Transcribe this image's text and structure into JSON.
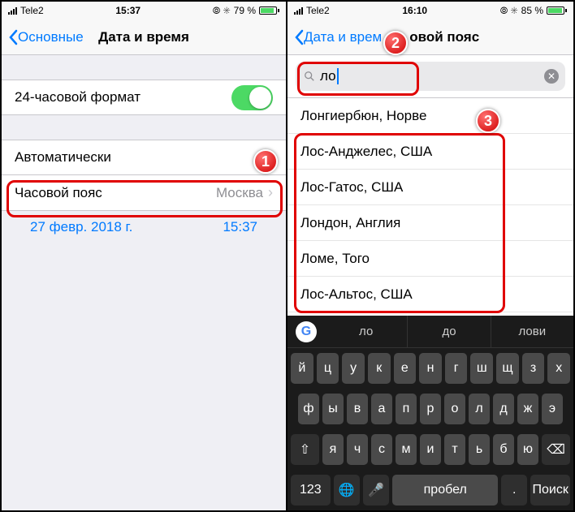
{
  "left": {
    "status": {
      "carrier": "Tele2",
      "time": "15:37",
      "bt": "79 %"
    },
    "nav": {
      "back": "Основные",
      "title": "Дата и время"
    },
    "toggle_label": "24-часовой формат",
    "auto_label": "Автоматически",
    "tz_label": "Часовой пояс",
    "tz_value": "Москва",
    "date": "27 февр. 2018 г.",
    "time": "15:37"
  },
  "right": {
    "status": {
      "carrier": "Tele2",
      "time": "16:10",
      "bt": "85 %"
    },
    "nav": {
      "back": "Дата и врем",
      "title": "овой пояс"
    },
    "search_text": "ло",
    "results": [
      "Лонгиербюн, Норве",
      "Лос-Анджелес, США",
      "Лос-Гатос, США",
      "Лондон, Англия",
      "Ломе, Того",
      "Лос-Альтос, США"
    ],
    "suggestions": [
      "ло",
      "до",
      "лови"
    ],
    "keys_r1": [
      "й",
      "ц",
      "у",
      "к",
      "е",
      "н",
      "г",
      "ш",
      "щ",
      "з",
      "х"
    ],
    "keys_r2": [
      "ф",
      "ы",
      "в",
      "а",
      "п",
      "р",
      "о",
      "л",
      "д",
      "ж",
      "э"
    ],
    "keys_r3": [
      "я",
      "ч",
      "с",
      "м",
      "и",
      "т",
      "ь",
      "б",
      "ю"
    ],
    "key_num": "123",
    "key_space": "пробел",
    "key_return": "Поиск"
  },
  "annotations": {
    "a1": "1",
    "a2": "2",
    "a3": "3"
  }
}
